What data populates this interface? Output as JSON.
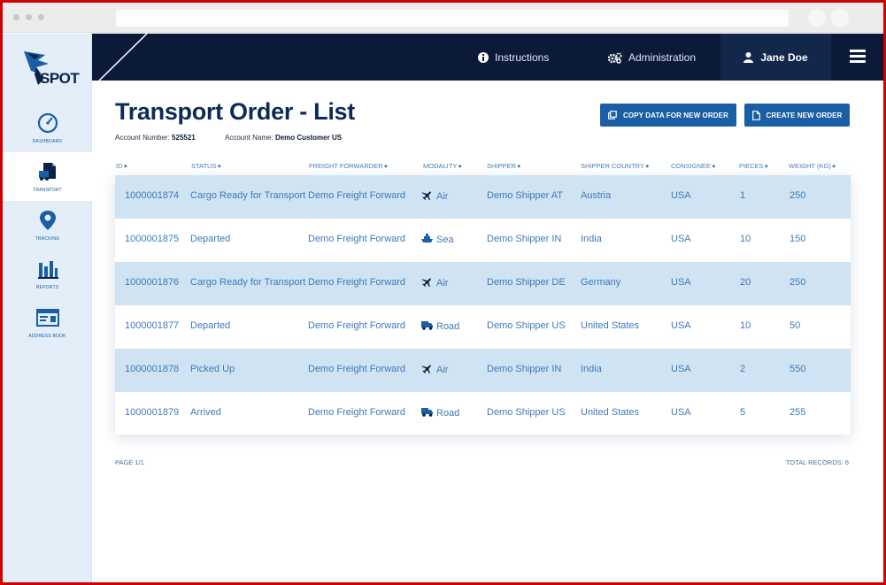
{
  "app": {
    "logo_text": "SPOT"
  },
  "sidebar": {
    "items": [
      {
        "label": "DASHBOARD",
        "icon": "gauge-icon"
      },
      {
        "label": "TRANSPORT",
        "icon": "truck-document-icon"
      },
      {
        "label": "TRACKING",
        "icon": "map-pin-icon"
      },
      {
        "label": "REPORTS",
        "icon": "bar-chart-icon"
      },
      {
        "label": "ADDRESS BOOK",
        "icon": "address-card-icon"
      }
    ],
    "active_index": 1
  },
  "topbar": {
    "instructions_label": "Instructions",
    "administration_label": "Administration",
    "user_name": "Jane Doe"
  },
  "page": {
    "title": "Transport Order - List",
    "account_number_label": "Account Number:",
    "account_number": "525521",
    "account_name_label": "Account Name:",
    "account_name": "Demo Customer US",
    "copy_button": "COPY DATA FOR NEW ORDER",
    "create_button": "CREATE NEW ORDER"
  },
  "table": {
    "columns": [
      "ID",
      "STATUS",
      "FREIGHT FORWARDER",
      "MODALITY",
      "SHIPPER",
      "SHIPPER COUNTRY",
      "CONSIGNEE",
      "PIECES",
      "WEIGHT (KG)"
    ],
    "rows": [
      {
        "id": "1000001874",
        "status": "Cargo Ready for Transport",
        "forwarder": "Demo Freight Forward",
        "modality": "Air",
        "modality_icon": "plane-icon",
        "shipper": "Demo Shipper AT",
        "country": "Austria",
        "consignee": "USA",
        "pieces": "1",
        "weight": "250"
      },
      {
        "id": "1000001875",
        "status": "Departed",
        "forwarder": "Demo Freight Forward",
        "modality": "Sea",
        "modality_icon": "ship-icon",
        "shipper": "Demo Shipper IN",
        "country": "India",
        "consignee": "USA",
        "pieces": "10",
        "weight": "150"
      },
      {
        "id": "1000001876",
        "status": "Cargo Ready for Transport",
        "forwarder": "Demo Freight Forward",
        "modality": "Air",
        "modality_icon": "plane-icon",
        "shipper": "Demo Shipper DE",
        "country": "Germany",
        "consignee": "USA",
        "pieces": "20",
        "weight": "250"
      },
      {
        "id": "1000001877",
        "status": "Departed",
        "forwarder": "Demo Freight Forward",
        "modality": "Road",
        "modality_icon": "truck-icon",
        "shipper": "Demo Shipper US",
        "country": "United States",
        "consignee": "USA",
        "pieces": "10",
        "weight": "50"
      },
      {
        "id": "1000001878",
        "status": "Picked Up",
        "forwarder": "Demo Freight Forward",
        "modality": "Air",
        "modality_icon": "plane-icon",
        "shipper": "Demo Shipper IN",
        "country": "India",
        "consignee": "USA",
        "pieces": "2",
        "weight": "550"
      },
      {
        "id": "1000001879",
        "status": "Arrived",
        "forwarder": "Demo Freight Forward",
        "modality": "Road",
        "modality_icon": "truck-icon",
        "shipper": "Demo Shipper US",
        "country": "United States",
        "consignee": "USA",
        "pieces": "5",
        "weight": "255"
      }
    ]
  },
  "footer": {
    "page_label": "PAGE 1/1",
    "total_label": "TOTAL RECORDS: 6"
  },
  "colors": {
    "navy": "#0c1a3a",
    "accent": "#1a5ea6",
    "row_alt": "#cfe3f3",
    "text_link": "#3f7ab8"
  }
}
